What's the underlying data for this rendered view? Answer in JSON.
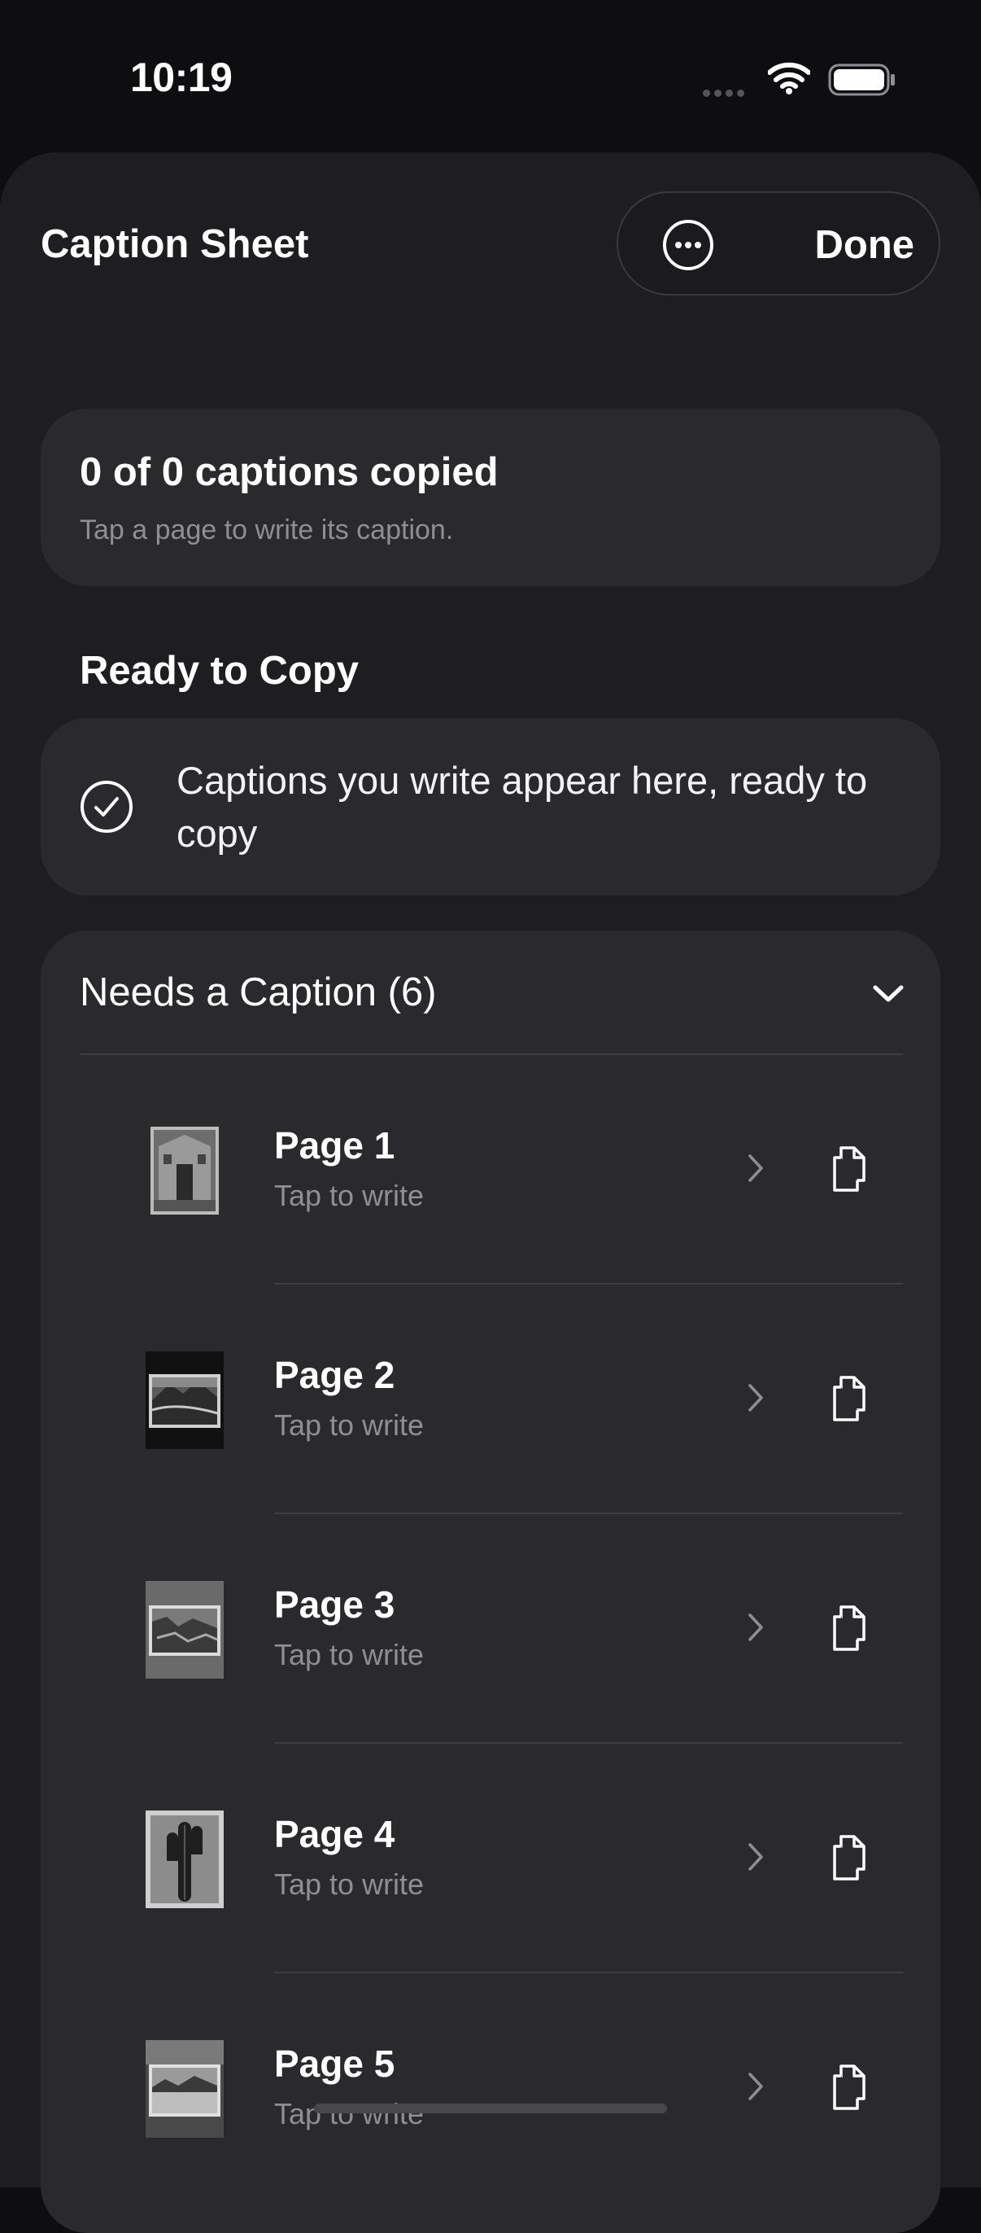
{
  "status": {
    "time": "10:19"
  },
  "header": {
    "title": "Caption Sheet",
    "done_label": "Done"
  },
  "summary": {
    "title": "0 of 0 captions copied",
    "subtitle": "Tap a page to write its caption."
  },
  "ready_section": {
    "title": "Ready to Copy",
    "empty_message": "Captions you write appear here, ready to copy"
  },
  "needs_section": {
    "title": "Needs a Caption (6)",
    "items": [
      {
        "label": "Page 1",
        "subtitle": "Tap to write",
        "thumb": "doorway-ruin"
      },
      {
        "label": "Page 2",
        "subtitle": "Tap to write",
        "thumb": "mountain-valley"
      },
      {
        "label": "Page 3",
        "subtitle": "Tap to write",
        "thumb": "canyon"
      },
      {
        "label": "Page 4",
        "subtitle": "Tap to write",
        "thumb": "saguaro-cactus"
      },
      {
        "label": "Page 5",
        "subtitle": "Tap to write",
        "thumb": "desert-lake"
      }
    ]
  },
  "icons": {
    "more": "ellipsis-circle-icon",
    "check": "checkmark-circle-icon",
    "collapse": "chevron-down-icon",
    "open": "chevron-right-icon",
    "copy": "copy-icon"
  }
}
